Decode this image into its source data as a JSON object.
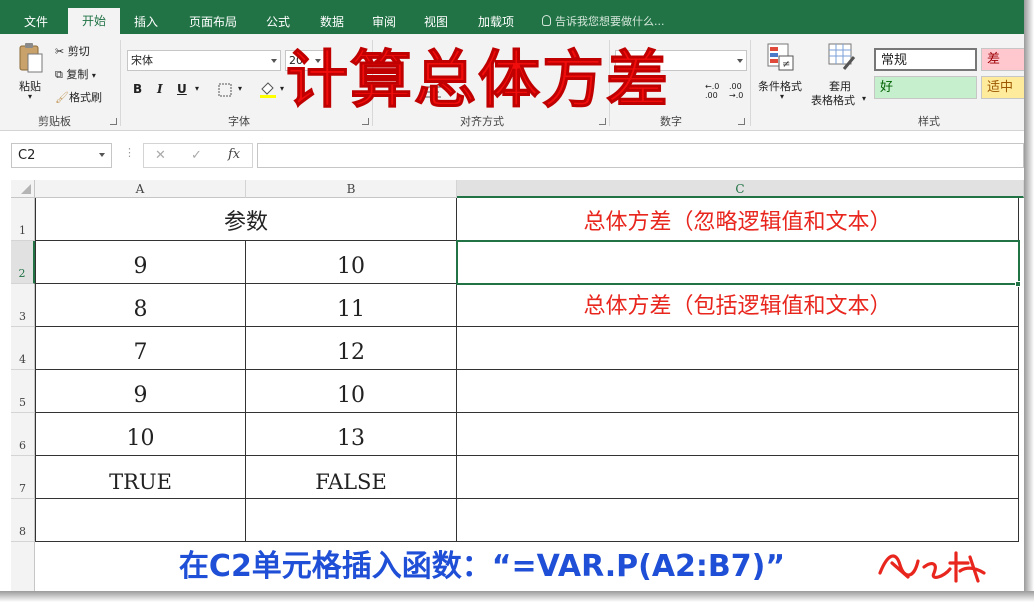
{
  "tabs": [
    "文件",
    "开始",
    "插入",
    "页面布局",
    "公式",
    "数据",
    "审阅",
    "视图",
    "加载项"
  ],
  "tell_me": "告诉我您想要做什么...",
  "clipboard": {
    "paste": "粘贴",
    "cut": "剪切",
    "copy": "复制",
    "format_painter": "格式刷",
    "group": "剪贴板"
  },
  "font": {
    "name": "宋体",
    "size": "20",
    "bold": "B",
    "italic": "I",
    "underline": "U",
    "group": "字体"
  },
  "alignment": {
    "group": "对齐方式"
  },
  "number": {
    "group": "数字",
    "format": "常规"
  },
  "styles": {
    "conditional": "条件格式",
    "table_line1": "套用",
    "table_line2": "表格格式",
    "normal": "常规",
    "bad": "差",
    "good": "好",
    "neutral": "适中",
    "group": "样式"
  },
  "overlay_title": "计算总体方差",
  "formula_bar": {
    "name_box": "C2",
    "cancel": "✕",
    "enter": "✓",
    "fx": "fx",
    "value": ""
  },
  "columns": [
    "A",
    "B",
    "C"
  ],
  "rows": [
    "1",
    "2",
    "3",
    "4",
    "5",
    "6",
    "7",
    "8"
  ],
  "header_cell": "参数",
  "data": [
    [
      "9",
      "10"
    ],
    [
      "8",
      "11"
    ],
    [
      "7",
      "12"
    ],
    [
      "9",
      "10"
    ],
    [
      "10",
      "13"
    ],
    [
      "TRUE",
      "FALSE"
    ]
  ],
  "c_column": {
    "c1": "总体方差（忽略逻辑值和文本）",
    "c3": "总体方差（包括逻辑值和文本）"
  },
  "caption": "在C2单元格插入函数：“=VAR.P(A2:B7)”",
  "signature": "ⓢ之峰",
  "colors": {
    "excel_green": "#217346",
    "red_text": "#e8261e",
    "caption_blue": "#1f4fd6"
  }
}
